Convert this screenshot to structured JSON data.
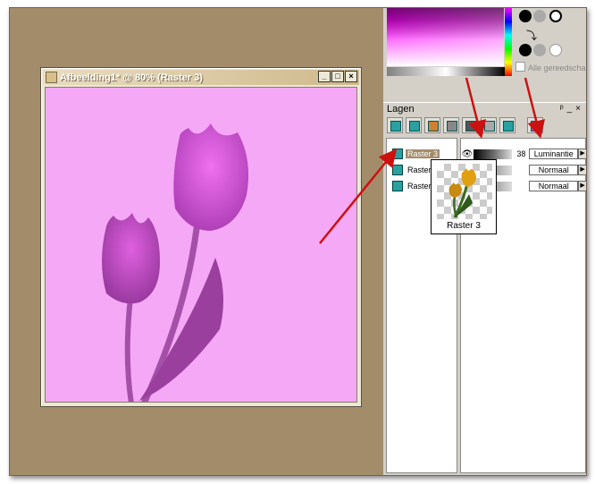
{
  "image_window": {
    "title": "Afbeelding1* @  80% (Raster 3)",
    "minimize": "_",
    "maximize": "□",
    "close": "×"
  },
  "materials": {
    "all_tools_label": "Alle gereedschap"
  },
  "layers_panel": {
    "title": "Lagen",
    "pin_glyph": "ᵖ",
    "min_glyph": "_",
    "close_glyph": "×",
    "layers": [
      {
        "name": "Raster 3",
        "selected": true,
        "opacity": "38",
        "blend": "Luminantie"
      },
      {
        "name": "Raster",
        "selected": false,
        "opacity": "",
        "blend": "Normaal"
      },
      {
        "name": "Raster",
        "selected": false,
        "opacity": "",
        "blend": "Normaal"
      }
    ]
  },
  "tooltip": {
    "caption": "Raster 3"
  },
  "colors": {
    "canvas": "#f5a8f5",
    "workspace": "#a38c6a",
    "arrow": "#cc1111"
  },
  "icons": [
    "eye-icon",
    "layer-icon",
    "dropdown-arrow-icon",
    "pin-icon",
    "close-icon"
  ]
}
